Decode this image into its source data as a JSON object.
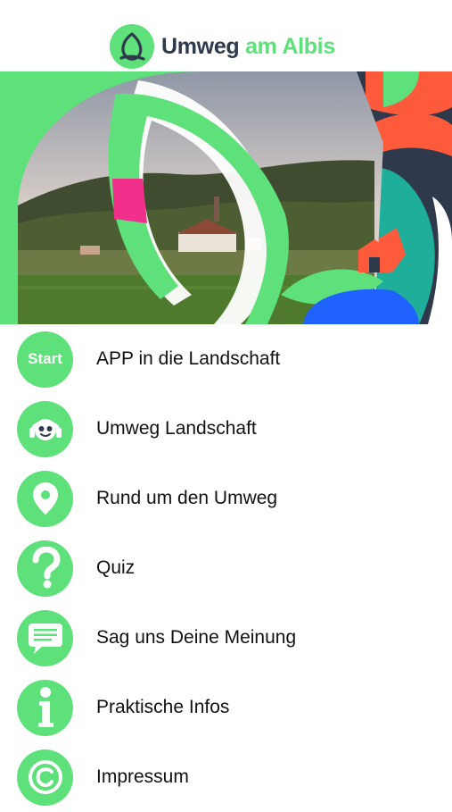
{
  "header": {
    "logo_word1": "Umweg",
    "logo_word2": "am Albis",
    "brand_green": "#5ee07a",
    "brand_dark": "#2e3a4b"
  },
  "hero": {
    "image": "village-landscape-with-leaf-graphics"
  },
  "menu": {
    "items": [
      {
        "icon": "start-icon",
        "icon_text": "Start",
        "label": "APP in die Landschaft"
      },
      {
        "icon": "headphones-face-icon",
        "label": "Umweg Landschaft"
      },
      {
        "icon": "map-pin-icon",
        "label": "Rund um den Umweg"
      },
      {
        "icon": "question-mark-icon",
        "label": "Quiz"
      },
      {
        "icon": "chat-bubble-icon",
        "label": "Sag uns Deine Meinung"
      },
      {
        "icon": "info-icon",
        "label": "Praktische Infos"
      },
      {
        "icon": "copyright-icon",
        "label": "Impressum"
      }
    ]
  }
}
